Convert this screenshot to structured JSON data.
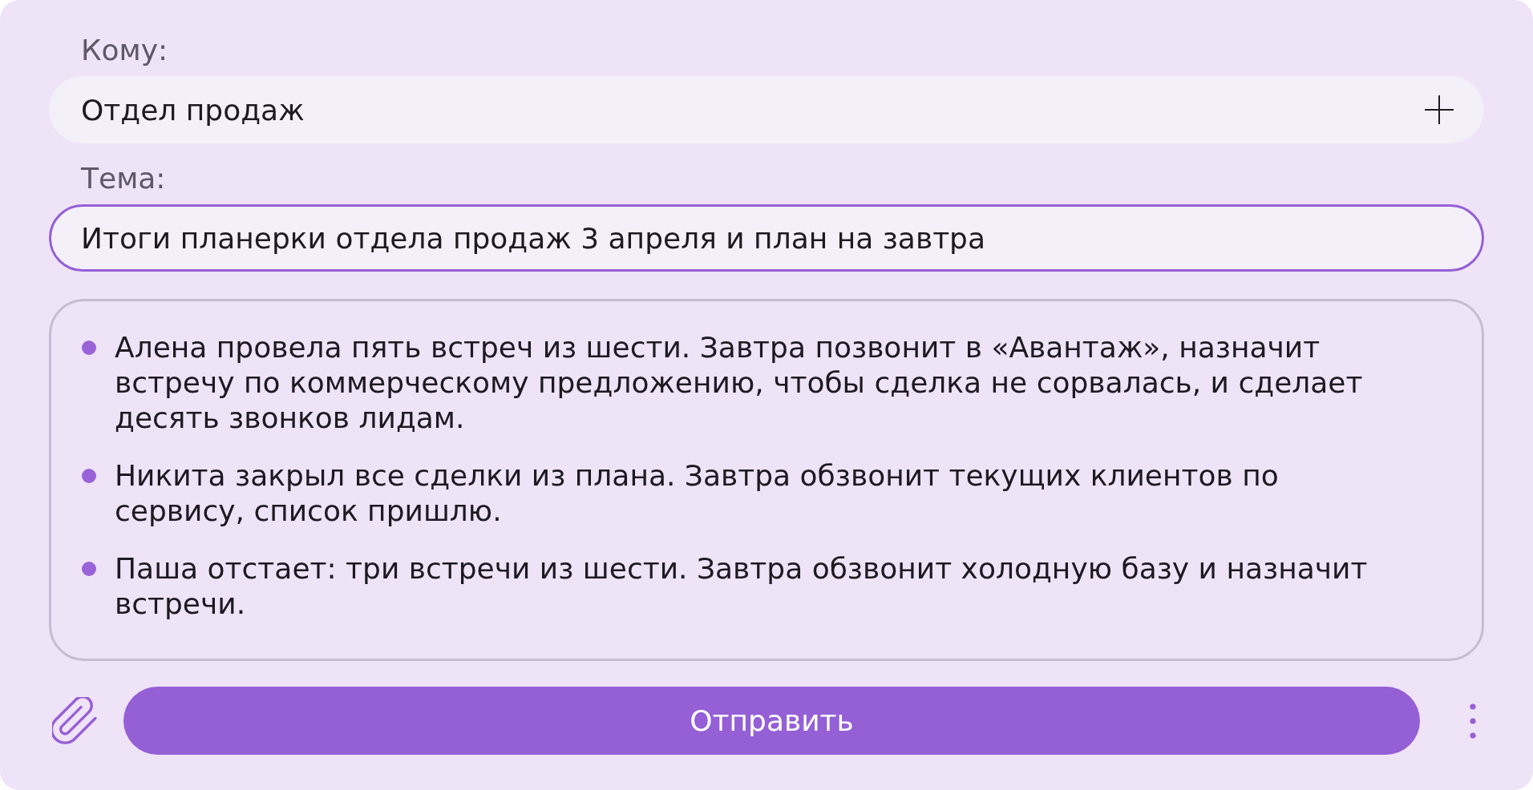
{
  "recipient": {
    "label": "Кому:",
    "value": "Отдел продаж",
    "focused": false
  },
  "subject": {
    "label": "Тема:",
    "value": "Итоги планерки отдела продаж 3 апреля и план на завтра",
    "focused": true
  },
  "message": {
    "items": [
      "Алена провела пять встреч из шести. Завтра позвонит в «Авантаж», назначит встречу по коммерческому предложению, чтобы сделка не сорвалась, и сделает десять звонков лидам.",
      "Никита закрыл все сделки из плана. Завтра обзвонит текущих клиентов по сервису, список пришлю.",
      "Паша отстает: три встречи из шести. Завтра обзвонит холодную базу и назначит встречи."
    ]
  },
  "send_button": {
    "label": "Отправить"
  }
}
